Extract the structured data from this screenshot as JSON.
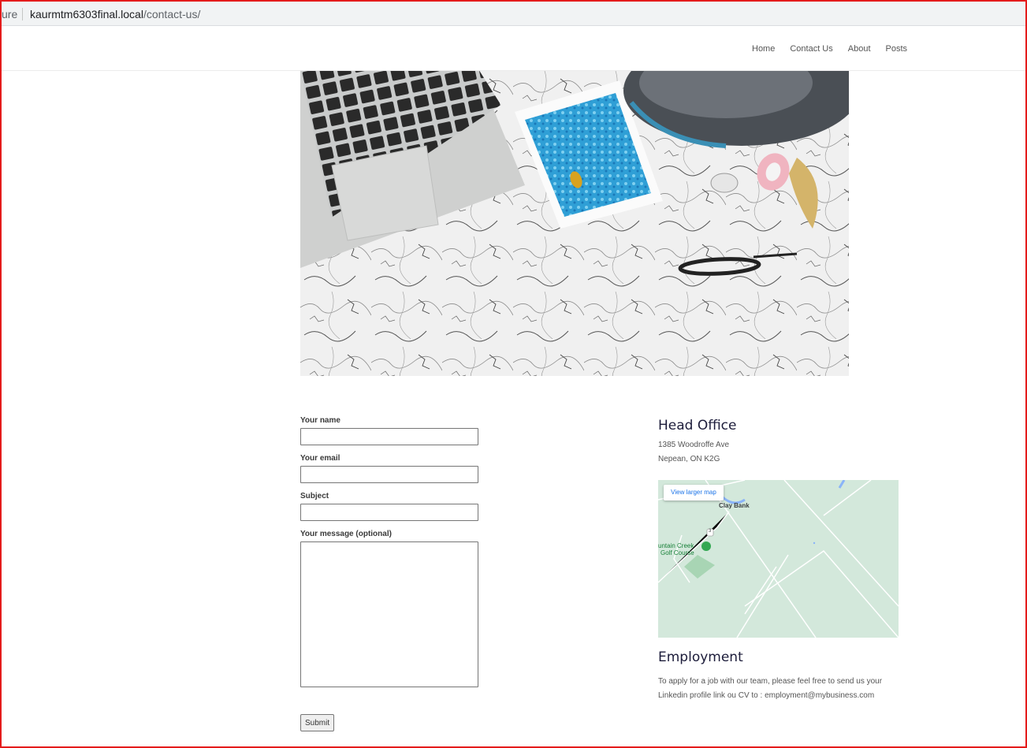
{
  "browser": {
    "url_prefix": "ure",
    "url_host": "kaurmtm6303final.local",
    "url_path": "/contact-us/"
  },
  "nav": {
    "items": [
      "Home",
      "Contact Us",
      "About",
      "Posts"
    ]
  },
  "form": {
    "name_label": "Your name",
    "email_label": "Your email",
    "subject_label": "Subject",
    "message_label": "Your message (optional)",
    "submit_label": "Submit"
  },
  "head_office": {
    "title": "Head Office",
    "address_line1": "1385 Woodroffe Ave",
    "address_line2": "Nepean, ON K2G"
  },
  "map": {
    "link_label": "View larger map",
    "place_label": "Clay Bank",
    "golf_label_line1": "untain Creek",
    "golf_label_line2": "Golf Course",
    "road_badge": "3"
  },
  "employment": {
    "title": "Employment",
    "text": "To apply for a job with our team, please feel free to send us your Linkedin profile link ou CV to : employment@mybusiness.com"
  }
}
